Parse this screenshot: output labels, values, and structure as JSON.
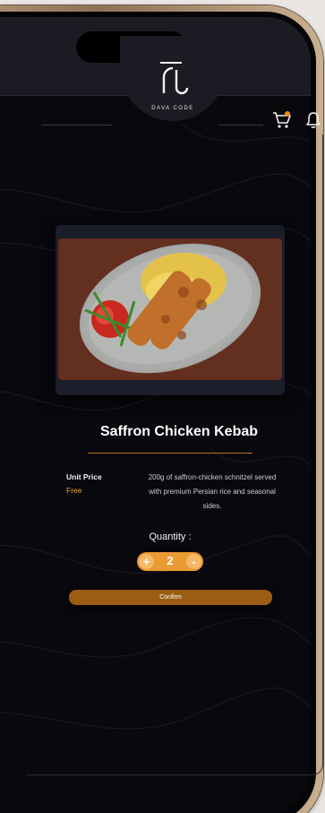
{
  "brand": {
    "logo_text": "DAVA CODE"
  },
  "header": {
    "cart_icon": "cart-icon",
    "notification_icon": "bell-icon",
    "accent": "#f28c13"
  },
  "product": {
    "name": "Saffron Chicken Kebab",
    "unit_price_label": "Unit Price",
    "unit_price_value": "Free",
    "description": "200g of saffron-chicken schnitzel served with premium Persian rice and seasonal sides."
  },
  "quantity": {
    "label": "Quantity :",
    "value": "2",
    "plus": "+",
    "minus": "-"
  },
  "actions": {
    "confirm_label": "Confirm"
  },
  "colors": {
    "accent": "#ea9a33",
    "confirm_bg": "#9b5e12",
    "background": "#08080d"
  }
}
